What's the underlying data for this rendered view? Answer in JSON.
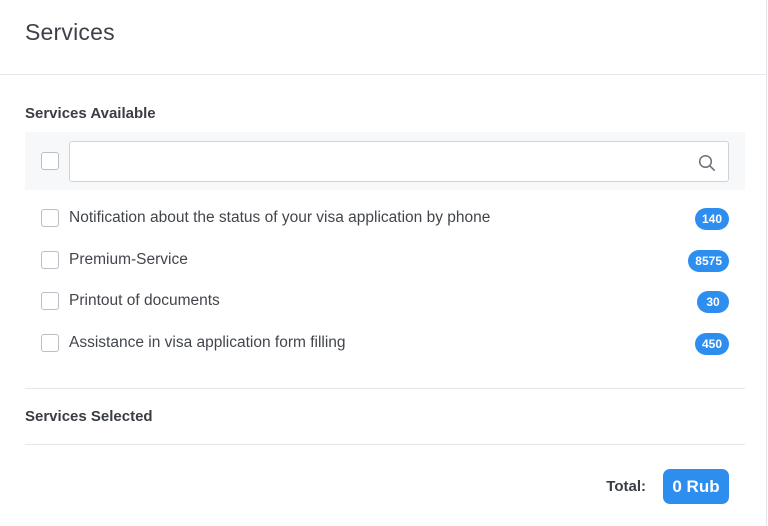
{
  "header": {
    "title": "Services"
  },
  "available": {
    "title": "Services Available",
    "search": {
      "value": "",
      "placeholder": "",
      "icon": "search-icon"
    },
    "items": [
      {
        "label": "Notification about the status of your visa application by phone",
        "price": "140",
        "checked": false
      },
      {
        "label": "Premium-Service",
        "price": "8575",
        "checked": false
      },
      {
        "label": "Printout of documents",
        "price": "30",
        "checked": false
      },
      {
        "label": "Assistance in visa application form filling",
        "price": "450",
        "checked": false
      }
    ]
  },
  "selected": {
    "title": "Services Selected"
  },
  "total": {
    "label": "Total:",
    "value": "0 Rub"
  },
  "colors": {
    "accent": "#2d8ef0",
    "filter_bg": "#f7f8fa",
    "divider": "#e3e6ea"
  }
}
